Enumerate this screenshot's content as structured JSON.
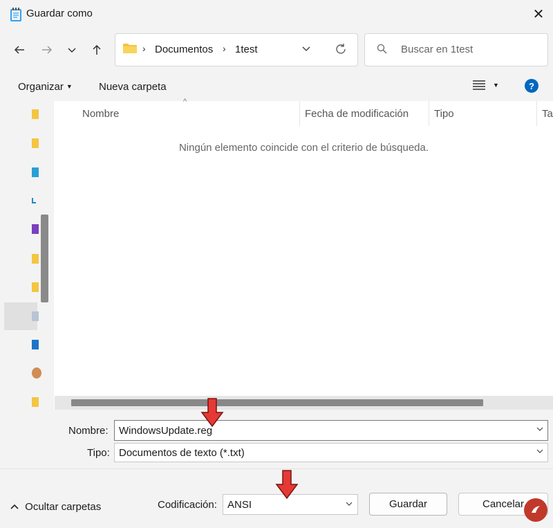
{
  "window": {
    "title": "Guardar como"
  },
  "address": {
    "segments": [
      "Documentos",
      "1test"
    ]
  },
  "search": {
    "placeholder": "Buscar en 1test"
  },
  "toolbar": {
    "organize": "Organizar",
    "new_folder": "Nueva carpeta"
  },
  "columns": [
    "Nombre",
    "Fecha de modificación",
    "Tipo",
    "Ta"
  ],
  "empty_message": "Ningún elemento coincide con el criterio de búsqueda.",
  "form": {
    "name_label": "Nombre:",
    "name_value": "WindowsUpdate.reg",
    "type_label": "Tipo:",
    "type_value": "Documentos de texto (*.txt)",
    "encoding_label": "Codificación:",
    "encoding_value": "ANSI"
  },
  "buttons": {
    "save": "Guardar",
    "cancel": "Cancelar",
    "hide_folders": "Ocultar carpetas"
  },
  "colors": {
    "annotation_arrow": "#e53935",
    "help": "#0067c0",
    "folder": "#f4c542"
  }
}
